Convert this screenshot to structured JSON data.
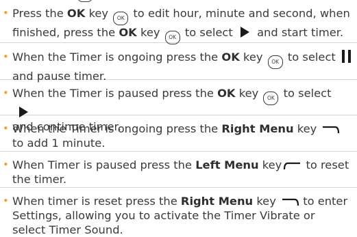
{
  "bullet_symbol": "•",
  "colors": {
    "bullet": "#f0a030",
    "text": "#3a3a3a",
    "divider": "#d5d5d5"
  },
  "ok_key_label": "OK",
  "items": [
    {
      "s": [
        "Press the ",
        "OK",
        " key ",
        " to edit hour, minute and second, when finished, press the ",
        "OK",
        " key ",
        " to select ",
        " and start timer."
      ]
    },
    {
      "s": [
        "When the Timer is ongoing press the ",
        "OK",
        " key ",
        " to select ",
        "and pause timer."
      ]
    },
    {
      "s": [
        "When the Timer is paused press the ",
        "OK",
        " key ",
        " to select ",
        "and continue timer."
      ]
    },
    {
      "s": [
        "When the Timer is ongoing press the ",
        "Right Menu",
        " key ",
        "to add 1 minute."
      ]
    },
    {
      "s": [
        "When Timer is paused press the ",
        "Left Menu",
        " key",
        " to reset the timer."
      ]
    },
    {
      "s": [
        "When timer is reset press the ",
        "Right Menu",
        " key ",
        " to enter Settings, allowing you to activate the Timer Vibrate or select Timer Sound."
      ]
    }
  ],
  "icons": {
    "ok_key": "ok-key-icon",
    "play": "play-icon",
    "pause": "pause-icon",
    "right_menu_key": "right-menu-key-icon",
    "left_menu_key": "left-menu-key-icon"
  }
}
